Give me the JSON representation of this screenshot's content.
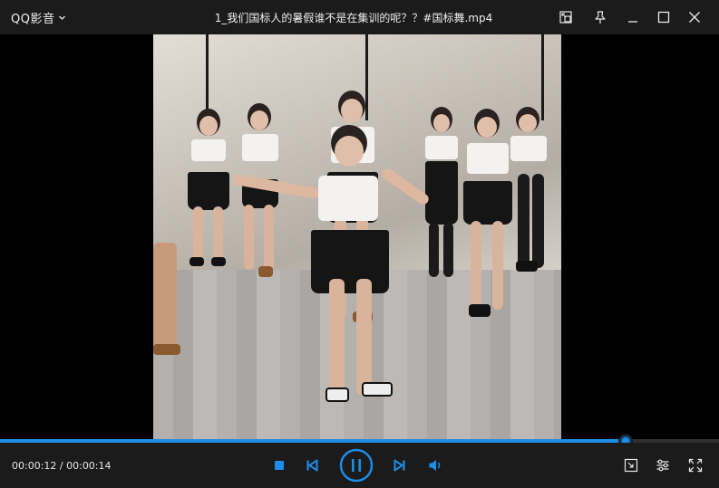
{
  "app": {
    "name": "QQ影音"
  },
  "window": {
    "title": "1_我们国标人的暑假谁不是在集训的呢？？#国标舞.mp4"
  },
  "playback": {
    "current_time": "00:00:12",
    "separator": " / ",
    "total_time": "00:00:14",
    "progress": 0.87,
    "state": "playing"
  },
  "colors": {
    "accent": "#1f8de6",
    "bar_background": "#1b1b1b",
    "video_background": "#000000"
  },
  "icons": {
    "app_menu": "chevron-down-icon",
    "mini_mode": "picture-in-picture-icon",
    "pin": "pin-icon",
    "minimize": "minimize-icon",
    "maximize": "maximize-icon",
    "close": "close-icon",
    "stop": "stop-icon",
    "previous": "skip-previous-icon",
    "play_pause": "pause-icon",
    "next": "skip-next-icon",
    "volume": "volume-icon",
    "screenshot": "screenshot-icon",
    "settings": "settings-sliders-icon",
    "fullscreen": "fullscreen-icon"
  }
}
